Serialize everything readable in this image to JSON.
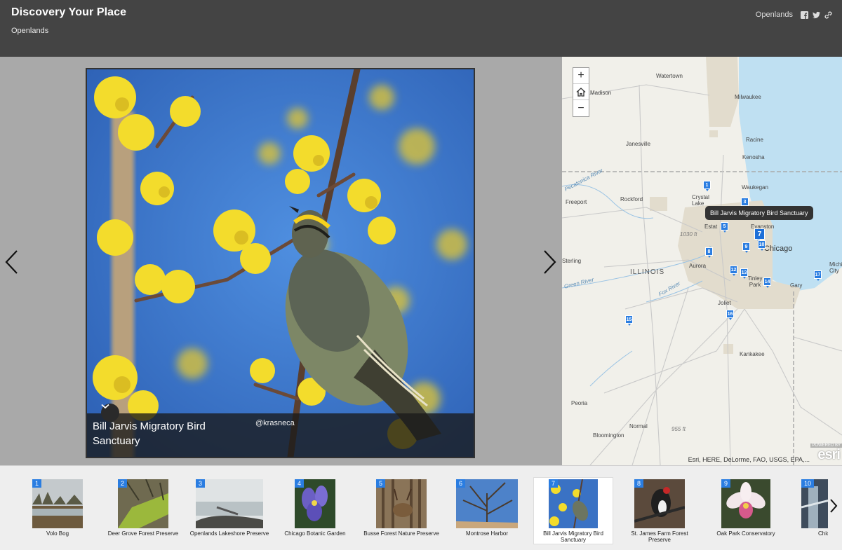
{
  "header": {
    "title": "Discovery Your Place",
    "subtitle": "Openlands",
    "brand_link": "Openlands",
    "social_icons": [
      "facebook-icon",
      "twitter-icon",
      "link-icon"
    ]
  },
  "media": {
    "caption_title": "Bill Jarvis Migratory Bird Sanctuary",
    "photo_credit": "@krasneca",
    "prev_icon": "chevron-left-icon",
    "next_icon": "chevron-right-icon",
    "toggle_icon": "chevron-down-icon"
  },
  "map": {
    "zoom_in": "+",
    "zoom_home": "home-icon",
    "zoom_out": "−",
    "tooltip": "Bill Jarvis Migratory Bird Sanctuary",
    "attribution": "Esri, HERE, DeLorme, FAO, USGS, EPA,...",
    "esri_logo": "esri",
    "powered_by": "POWERED BY",
    "labels": {
      "watertown": "Watertown",
      "madison": "Madison",
      "milwaukee": "Milwaukee",
      "racine": "Racine",
      "janesville": "Janesville",
      "kenosha": "Kenosha",
      "waukegan": "Waukegan",
      "crystal_lake": "Crystal Lake",
      "freeport": "Freeport",
      "rockford": "Rockford",
      "evanston": "Evanston",
      "estates": "Estat",
      "elev_1030": "1030 ft",
      "chicago": "Chicago",
      "sterling": "Sterling",
      "illinois": "ILLINOIS",
      "aurora": "Aurora",
      "tinley_park": "Tinley Park",
      "gary": "Gary",
      "michigan_city": "Michigan City",
      "joliet": "Joliet",
      "kankakee": "Kankakee",
      "peoria": "Peoria",
      "normal": "Normal",
      "elev_955": "955 ft",
      "bloomington": "Bloomington",
      "pecatonica_river": "Pecatonica River",
      "fox_river": "Fox River",
      "green_river": "Green River"
    },
    "markers": [
      "1",
      "3",
      "5",
      "7",
      "9",
      "10",
      "8",
      "12",
      "13",
      "14",
      "16",
      "15",
      "17"
    ]
  },
  "carousel": {
    "next_icon": "chevron-right-icon",
    "items": [
      {
        "num": "1",
        "label": "Volo Bog"
      },
      {
        "num": "2",
        "label": "Deer Grove Forest Preserve"
      },
      {
        "num": "3",
        "label": "Openlands Lakeshore Preserve"
      },
      {
        "num": "4",
        "label": "Chicago Botanic Garden"
      },
      {
        "num": "5",
        "label": "Busse Forest Nature Preserve"
      },
      {
        "num": "6",
        "label": "Montrose Harbor"
      },
      {
        "num": "7",
        "label": "Bill Jarvis Migratory Bird Sanctuary"
      },
      {
        "num": "8",
        "label": "St. James Farm Forest Preserve"
      },
      {
        "num": "9",
        "label": "Oak Park Conservatory"
      },
      {
        "num": "10",
        "label": "Chic"
      }
    ]
  },
  "colors": {
    "header_bg": "#444444",
    "accent": "#2a7de1",
    "lake": "#bfe0f2"
  }
}
